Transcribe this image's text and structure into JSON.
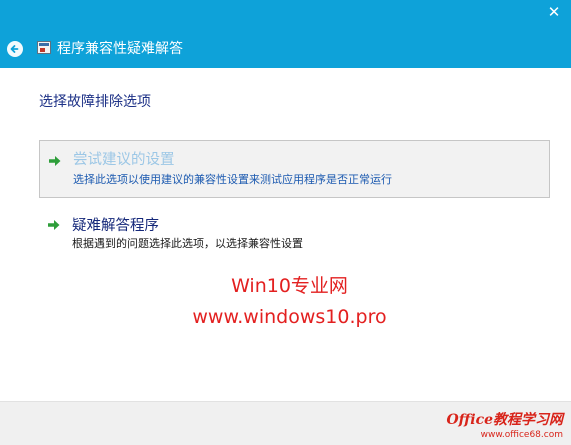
{
  "window": {
    "title": "程序兼容性疑难解答",
    "close_glyph": "✕"
  },
  "heading": "选择故障排除选项",
  "options": [
    {
      "title": "尝试建议的设置",
      "description": "选择此选项以使用建议的兼容性设置来测试应用程序是否正常运行",
      "icon": "green-arrow-icon"
    },
    {
      "title": "疑难解答程序",
      "description": "根据遇到的问题选择此选项，以选择兼容性设置",
      "icon": "green-arrow-icon"
    }
  ],
  "watermark": {
    "line1": "Win10专业网",
    "line2": "www.windows10.pro"
  },
  "badge": {
    "main": "Office教程学习网",
    "sub": "www.office68.com"
  },
  "colors": {
    "titlebar": "#0ea2d9",
    "heading": "#1e3287",
    "accent_green": "#2e9e3a",
    "watermark": "#e32020"
  }
}
